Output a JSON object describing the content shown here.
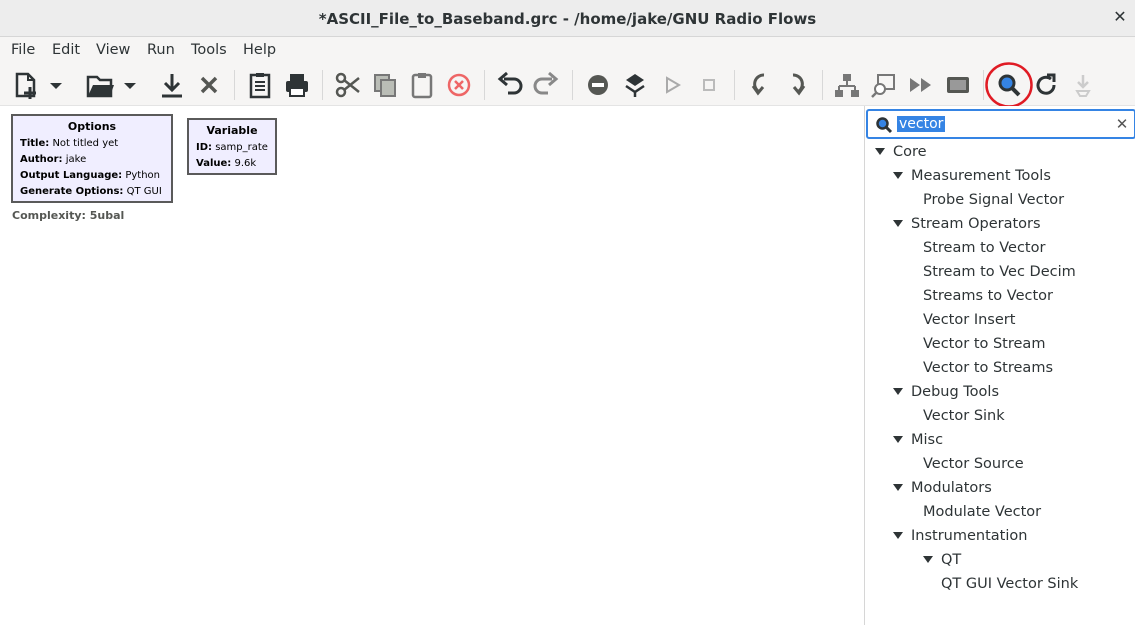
{
  "window": {
    "title": "*ASCII_File_to_Baseband.grc - /home/jake/GNU Radio Flows"
  },
  "menu": [
    "File",
    "Edit",
    "View",
    "Run",
    "Tools",
    "Help"
  ],
  "toolbar": {
    "icons": [
      "new-file-icon",
      "dropdown-arrow-icon",
      "open-file-icon",
      "dropdown-arrow-icon",
      "save-icon",
      "close-x-icon",
      "clipboard-list-icon",
      "print-icon",
      "cut-icon",
      "copy-icon",
      "paste-icon",
      "delete-icon",
      "undo-icon",
      "redo-icon",
      "disable-block-icon",
      "bypass-block-icon",
      "execute-icon",
      "stop-icon",
      "rotate-ccw-icon",
      "rotate-cw-icon",
      "hierarchy-icon",
      "find-block-icon",
      "forward-icon",
      "screenshot-icon",
      "search-icon",
      "reload-icon",
      "more-icon"
    ],
    "highlight_color": "#e01b24"
  },
  "blocks": [
    {
      "title": "Options",
      "fields": [
        {
          "key": "Title:",
          "value": "Not titled yet"
        },
        {
          "key": "Author:",
          "value": "jake"
        },
        {
          "key": "Output Language:",
          "value": "Python"
        },
        {
          "key": "Generate Options:",
          "value": "QT GUI"
        }
      ]
    },
    {
      "title": "Variable",
      "fields": [
        {
          "key": "ID:",
          "value": "samp_rate"
        },
        {
          "key": "Value:",
          "value": "9.6k"
        }
      ]
    }
  ],
  "complexity": "Complexity: 5ubal",
  "search": {
    "query": "vector"
  },
  "tree": [
    {
      "label": "Core",
      "expanded": true,
      "level": 0
    },
    {
      "label": "Measurement Tools",
      "expanded": true,
      "level": 1
    },
    {
      "label": "Probe Signal Vector",
      "level": 2
    },
    {
      "label": "Stream Operators",
      "expanded": true,
      "level": 1
    },
    {
      "label": "Stream to Vector",
      "level": 2
    },
    {
      "label": "Stream to Vec Decim",
      "level": 2
    },
    {
      "label": "Streams to Vector",
      "level": 2
    },
    {
      "label": "Vector Insert",
      "level": 2
    },
    {
      "label": "Vector to Stream",
      "level": 2
    },
    {
      "label": "Vector to Streams",
      "level": 2
    },
    {
      "label": "Debug Tools",
      "expanded": true,
      "level": 1
    },
    {
      "label": "Vector Sink",
      "level": 2
    },
    {
      "label": "Misc",
      "expanded": true,
      "level": 1
    },
    {
      "label": "Vector Source",
      "level": 2
    },
    {
      "label": "Modulators",
      "expanded": true,
      "level": 1
    },
    {
      "label": "Modulate Vector",
      "level": 2
    },
    {
      "label": "Instrumentation",
      "expanded": true,
      "level": 1
    },
    {
      "label": "QT",
      "expanded": true,
      "level": 2
    },
    {
      "label": "QT GUI Vector Sink",
      "level": 3
    }
  ]
}
